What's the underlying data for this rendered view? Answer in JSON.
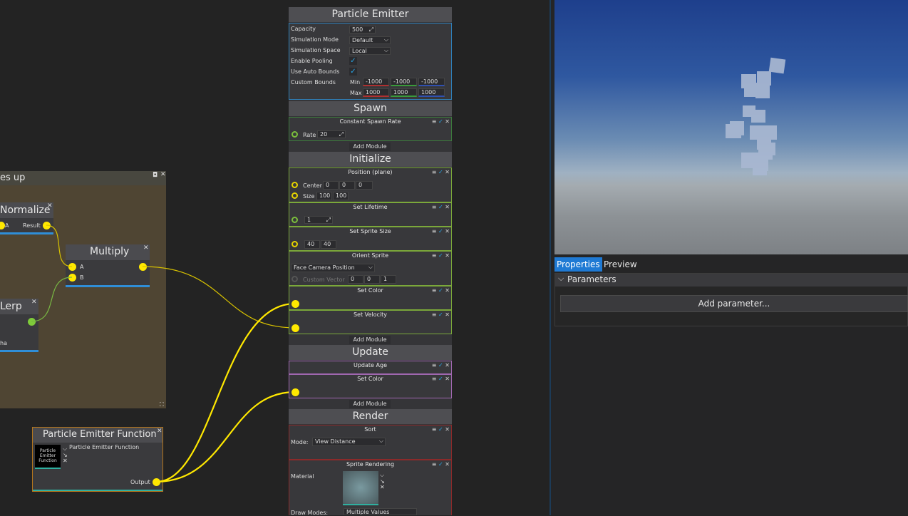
{
  "graph": {
    "comment_title": "es up",
    "nodes": {
      "normalize": {
        "title": "Normalize",
        "pin_a": "A",
        "pin_result": "Result"
      },
      "multiply": {
        "title": "Multiply",
        "pin_a": "A",
        "pin_b": "B"
      },
      "lerp": {
        "title": "Lerp",
        "pin_alpha": "ha"
      },
      "function": {
        "title": "Particle Emitter Function",
        "asset_name": "Particle Emitter Function",
        "thumb_text": "Particle Emitter Function",
        "output": "Output"
      }
    }
  },
  "emitter": {
    "title": "Particle Emitter",
    "props": {
      "capacity_label": "Capacity",
      "capacity_value": "500",
      "sim_mode_label": "Simulation Mode",
      "sim_mode_value": "Default",
      "sim_space_label": "Simulation Space",
      "sim_space_value": "Local",
      "pooling_label": "Enable Pooling",
      "autobounds_label": "Use Auto Bounds",
      "bounds_label": "Custom Bounds",
      "min_label": "Min",
      "max_label": "Max",
      "min_values": [
        "-1000",
        "-1000",
        "-1000"
      ],
      "max_values": [
        "1000",
        "1000",
        "1000"
      ]
    },
    "sections": {
      "spawn": "Spawn",
      "initialize": "Initialize",
      "update": "Update",
      "render": "Render"
    },
    "add_module": "Add Module",
    "modules": {
      "spawn_rate": {
        "title": "Constant Spawn Rate",
        "rate_label": "Rate",
        "rate_value": "20"
      },
      "position": {
        "title": "Position (plane)",
        "center_label": "Center",
        "center": [
          "0",
          "0",
          "0"
        ],
        "size_label": "Size",
        "size": [
          "100",
          "100"
        ]
      },
      "lifetime": {
        "title": "Set Lifetime",
        "value": "1"
      },
      "sprite_size": {
        "title": "Set Sprite Size",
        "values": [
          "40",
          "40"
        ]
      },
      "orient": {
        "title": "Orient Sprite",
        "mode": "Face Camera Position",
        "custom_label": "Custom Vector",
        "custom": [
          "0",
          "0",
          "1"
        ]
      },
      "color_init": {
        "title": "Set Color"
      },
      "velocity": {
        "title": "Set Velocity"
      },
      "update_age": {
        "title": "Update Age"
      },
      "color_update": {
        "title": "Set Color"
      },
      "sort": {
        "title": "Sort",
        "mode_label": "Mode:",
        "mode_value": "View Distance"
      },
      "sprite_render": {
        "title": "Sprite Rendering",
        "material_label": "Material",
        "draw_modes_label": "Draw Modes:",
        "draw_modes_value": "Multiple Values"
      }
    }
  },
  "properties_panel": {
    "tabs": [
      "Properties",
      "Preview"
    ],
    "group": "Parameters",
    "add_param": "Add parameter..."
  },
  "colors": {
    "accent": "#1f7ad4",
    "pin_yellow": "#ffe800",
    "module_green": "#7ba83a",
    "module_purple": "#a067b0",
    "module_red": "#8c2a2a"
  }
}
